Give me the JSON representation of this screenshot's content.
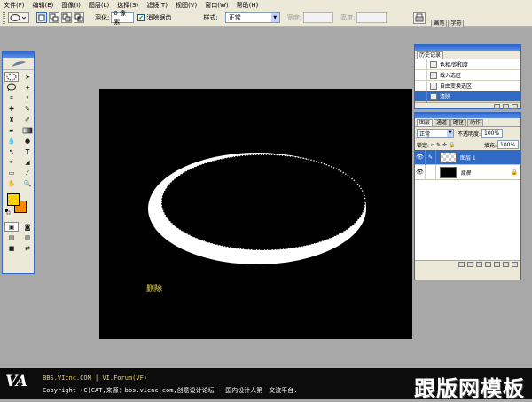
{
  "menu": {
    "items": [
      "文件(F)",
      "编辑(E)",
      "图像(I)",
      "图层(L)",
      "选择(S)",
      "滤镜(T)",
      "视图(V)",
      "窗口(W)",
      "帮助(H)"
    ]
  },
  "options": {
    "feather_label": "羽化:",
    "feather_value": "0 像素",
    "antialias_label": "消除锯齿",
    "style_label": "样式:",
    "style_value": "正常",
    "width_label": "宽度:",
    "height_label": "高度:",
    "tab_brushes": "画笔",
    "tab_chars": "字符"
  },
  "canvas": {
    "label": "删除",
    "background": "#000000",
    "ring_color": "#ffffff"
  },
  "history": {
    "title": "历史记录",
    "items": [
      "色相/饱和度",
      "载入选区",
      "自由变换选区",
      "清除"
    ],
    "selected_index": 3
  },
  "layers": {
    "tabs": [
      "图层",
      "通道",
      "路径",
      "动作"
    ],
    "blend_mode": "正常",
    "opacity_label": "不透明度:",
    "opacity_value": "100%",
    "lock_label": "锁定:",
    "fill_label": "填充:",
    "fill_value": "100%",
    "items": [
      {
        "name": "图层 1",
        "selected": true
      },
      {
        "name": "背景",
        "selected": false
      }
    ]
  },
  "colors": {
    "foreground": "#ffd200",
    "background": "#ff8a00",
    "accent": "#316ac5"
  },
  "banner": {
    "logo": "VA",
    "line1": "BBS.VIcnc.COM | VI.Forum(VF)",
    "line2": "Copyright (C)CAT,来源：bbs.vicnc.com,创意设计论坛 - 国内设计人第一交流平台.",
    "brand": "跟版网模板"
  }
}
